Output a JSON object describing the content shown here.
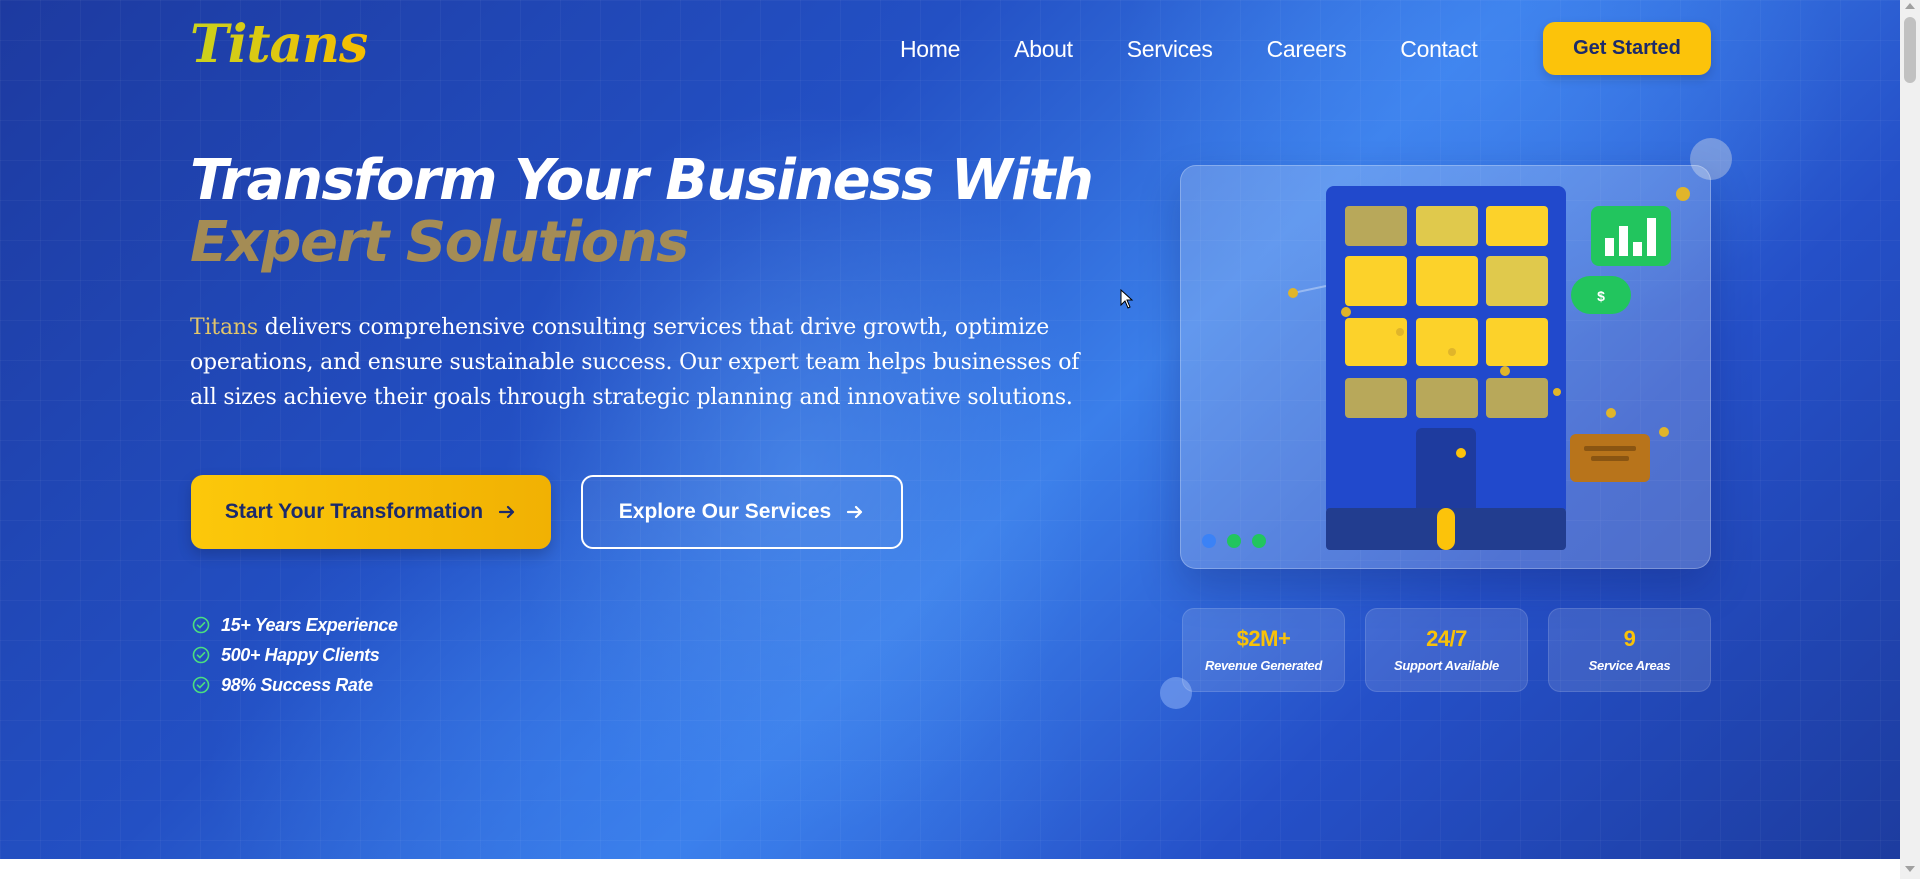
{
  "brand": {
    "logo_text": "Titans",
    "accent_color": "#fcc30a",
    "primary_color": "#2350c4"
  },
  "nav": {
    "items": [
      {
        "label": "Home"
      },
      {
        "label": "About"
      },
      {
        "label": "Services"
      },
      {
        "label": "Careers"
      },
      {
        "label": "Contact"
      }
    ],
    "cta_label": "Get Started"
  },
  "hero": {
    "title_line1": "Transform Your Business With",
    "title_line2": "Expert Solutions",
    "description_brand": "Titans",
    "description_rest": " delivers comprehensive consulting services that drive growth, optimize operations, and ensure sustainable success. Our expert team helps businesses of all sizes achieve their goals through strategic planning and innovative solutions.",
    "primary_button": "Start Your Transformation",
    "secondary_button": "Explore Our Services",
    "highlights": [
      {
        "icon": "check-circle-icon",
        "text": "15+ Years Experience"
      },
      {
        "icon": "check-circle-icon",
        "text": "500+ Happy Clients"
      },
      {
        "icon": "check-circle-icon",
        "text": "98% Success Rate"
      }
    ]
  },
  "illustration": {
    "icons": [
      "building-icon",
      "bar-chart-icon",
      "dollar-badge-icon",
      "briefcase-icon"
    ],
    "window_colors": [
      "#fcd22a",
      "#b8a85a",
      "#e0c94c"
    ]
  },
  "stats": [
    {
      "value": "$2M+",
      "label": "Revenue Generated"
    },
    {
      "value": "24/7",
      "label": "Support Available"
    },
    {
      "value": "9",
      "label": "Service Areas"
    }
  ]
}
